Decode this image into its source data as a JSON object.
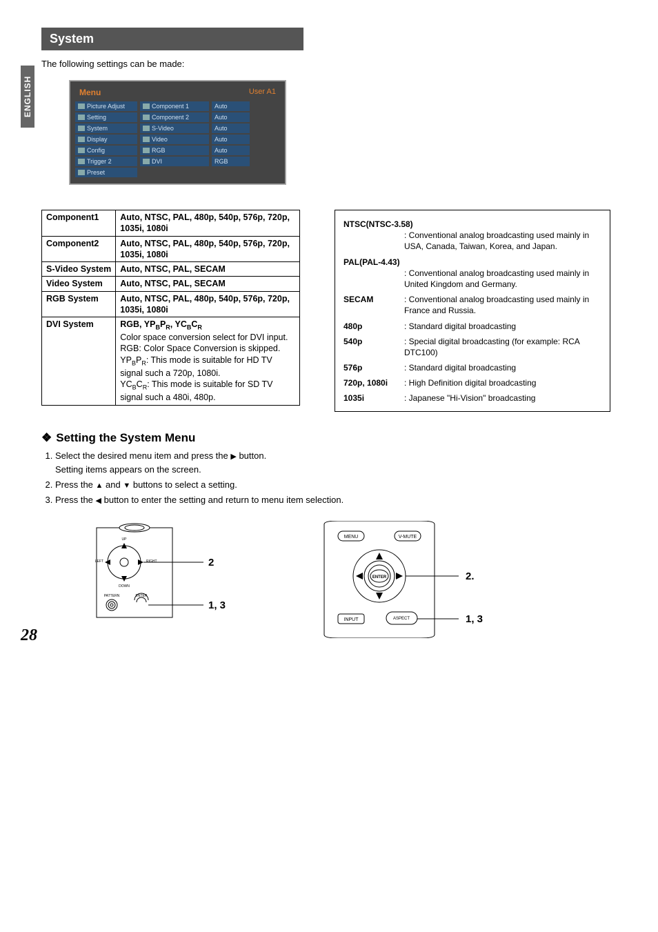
{
  "side_tab": "ENGLISH",
  "header": "System",
  "intro": "The following settings can be made:",
  "menu": {
    "title": "Menu",
    "user": "User A1",
    "left": [
      "Picture Adjust",
      "Setting",
      "System",
      "Display",
      "Config",
      "Trigger 2",
      "Preset"
    ],
    "mid": [
      "Component 1",
      "Component 2",
      "S-Video",
      "Video",
      "RGB",
      "DVI"
    ],
    "right": [
      "Auto",
      "Auto",
      "Auto",
      "Auto",
      "Auto",
      "RGB"
    ]
  },
  "spec": {
    "rows": [
      {
        "k": "Component1",
        "v": "Auto, NTSC, PAL, 480p, 540p, 576p, 720p, 1035i, 1080i",
        "bold": true
      },
      {
        "k": "Component2",
        "v": "Auto, NTSC, PAL, 480p, 540p, 576p, 720p, 1035i, 1080i",
        "bold": true
      },
      {
        "k": "S-Video System",
        "v": "Auto, NTSC, PAL, SECAM",
        "bold": true
      },
      {
        "k": "Video System",
        "v": "Auto, NTSC, PAL, SECAM",
        "bold": true
      },
      {
        "k": "RGB System",
        "v": "Auto, NTSC, PAL, 480p, 540p, 576p, 720p, 1035i, 1080i",
        "bold": true
      }
    ],
    "dvi_k": "DVI System",
    "dvi_h": "RGB, YPBPR, YCBCR",
    "dvi_lines": [
      "Color space conversion select for DVI input.",
      "RGB: Color Space Conversion is skipped.",
      "YPBPR: This mode is suitable for HD TV signal such a 720p, 1080i.",
      "YCBCR: This mode is suitable for SD TV signal such a 480i, 480p."
    ]
  },
  "defs": {
    "ntsc_h": "NTSC(NTSC-3.58)",
    "ntsc_v": "Conventional analog broadcasting used mainly in USA, Canada, Taiwan, Korea, and Japan.",
    "pal_h": "PAL(PAL-4.43)",
    "pal_v": "Conventional analog broadcasting used mainly in United Kingdom and Germany.",
    "rows": [
      {
        "k": "SECAM",
        "v": "Conventional analog broadcasting used mainly in France and Russia."
      },
      {
        "k": "480p",
        "v": "Standard digital broadcasting"
      },
      {
        "k": "540p",
        "v": "Special digital broadcasting (for example: RCA DTC100)"
      },
      {
        "k": "576p",
        "v": "Standard digital broadcasting"
      },
      {
        "k": "720p, 1080i",
        "v": "High Definition digital broadcasting"
      },
      {
        "k": "1035i",
        "v": "Japanese \"Hi-Vision\" broadcasting"
      }
    ]
  },
  "steps_h": "Setting the System Menu",
  "steps": [
    "Select the desired menu item and press the ▶ button. Setting items appears on the screen.",
    "Press the ▲ and ▼ buttons to select a setting.",
    "Press the ◀ button to enter the setting and return to menu item selection."
  ],
  "diag_labels": {
    "menu": "MENU",
    "vmute": "V-MUTE",
    "enter": "ENTER",
    "input": "INPUT",
    "aspect": "ASPECT"
  },
  "callouts": {
    "c2": "2",
    "c13": "1, 3",
    "c2b": "2.",
    "c13b": "1, 3"
  },
  "page": "28"
}
